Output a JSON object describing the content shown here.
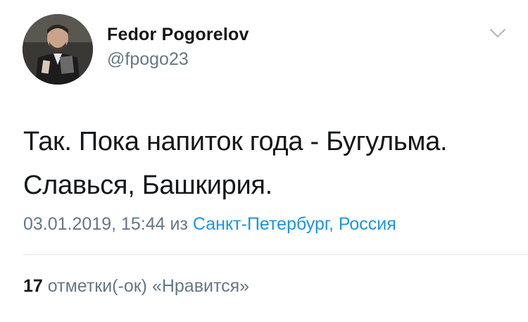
{
  "tweet": {
    "author": {
      "display_name": "Fedor Pogorelov",
      "handle": "@fpogo23",
      "avatar_icon": "avatar-photo"
    },
    "menu_icon": "chevron-down-icon",
    "text_lines": [
      "Так. Пока напиток года - Бугульма.",
      "Славься, Башкирия."
    ],
    "timestamp": "03.01.2019, 15:44",
    "location_prefix": "из",
    "location": "Санкт-Петербург, Россия",
    "likes_count": "17",
    "likes_label": "отметки(-ок) «Нравится»"
  },
  "colors": {
    "text": "#14171a",
    "secondary": "#657786",
    "link": "#1b95e0",
    "divider": "#e1e8ed"
  }
}
